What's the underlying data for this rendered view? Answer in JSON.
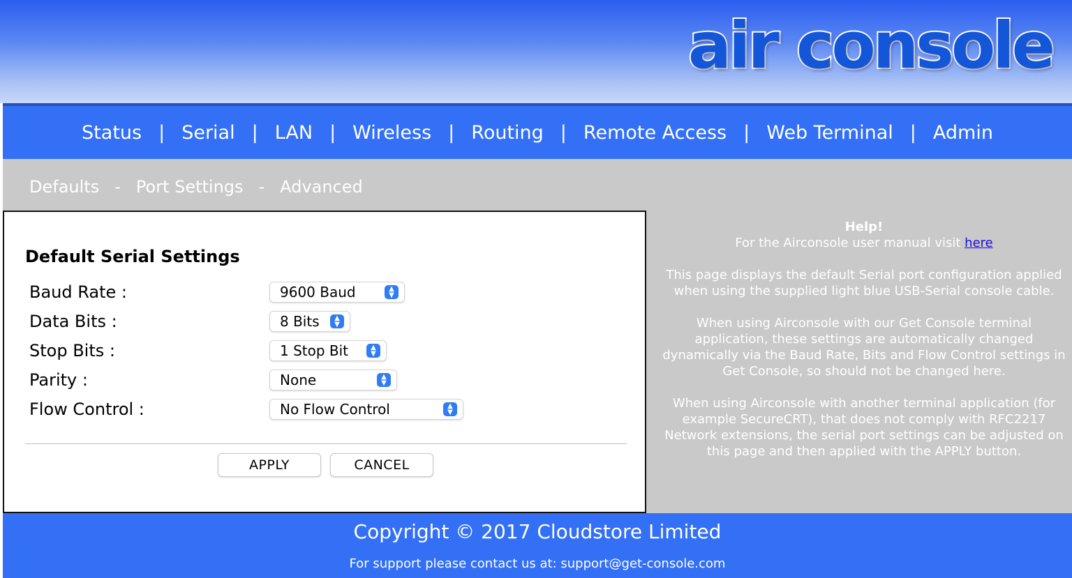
{
  "header": {
    "logo_text": "air console"
  },
  "nav": {
    "items": [
      {
        "label": "Status"
      },
      {
        "label": "Serial"
      },
      {
        "label": "LAN"
      },
      {
        "label": "Wireless"
      },
      {
        "label": "Routing"
      },
      {
        "label": "Remote Access"
      },
      {
        "label": "Web Terminal"
      },
      {
        "label": "Admin"
      }
    ],
    "separator": "|"
  },
  "subnav": {
    "items": [
      {
        "label": "Defaults"
      },
      {
        "label": "Port Settings"
      },
      {
        "label": "Advanced"
      }
    ],
    "separator": "-"
  },
  "form": {
    "title": "Default Serial Settings",
    "fields": [
      {
        "label": "Baud Rate :",
        "value": "9600 Baud"
      },
      {
        "label": "Data Bits :",
        "value": "8 Bits"
      },
      {
        "label": "Stop Bits :",
        "value": "1 Stop Bit"
      },
      {
        "label": "Parity :",
        "value": "None"
      },
      {
        "label": "Flow Control :",
        "value": "No Flow Control"
      }
    ],
    "apply_label": "APPLY",
    "cancel_label": "CANCEL"
  },
  "help": {
    "title": "Help!",
    "manual_text": "For the Airconsole user manual visit ",
    "manual_link": "here",
    "para1": "This page displays the default Serial port configuration applied when using the supplied light blue USB-Serial console cable.",
    "para2": "When using Airconsole with our Get Console terminal application, these settings are automatically changed dynamically via the Baud Rate, Bits and Flow Control settings in Get Console, so should not be changed here.",
    "para3": "When using Airconsole with another terminal application (for example SecureCRT), that does not comply with RFC2217 Network extensions, the serial port settings can be adjusted on this page and then applied with the APPLY button."
  },
  "footer": {
    "copyright": "Copyright © 2017 Cloudstore Limited",
    "support": "For support please contact us at: support@get-console.com"
  },
  "colors": {
    "nav_blue": "#3370f5",
    "select_accent": "#2e7cf6",
    "content_gray": "#c9c9c9",
    "link_blue": "#1a0dd8"
  }
}
